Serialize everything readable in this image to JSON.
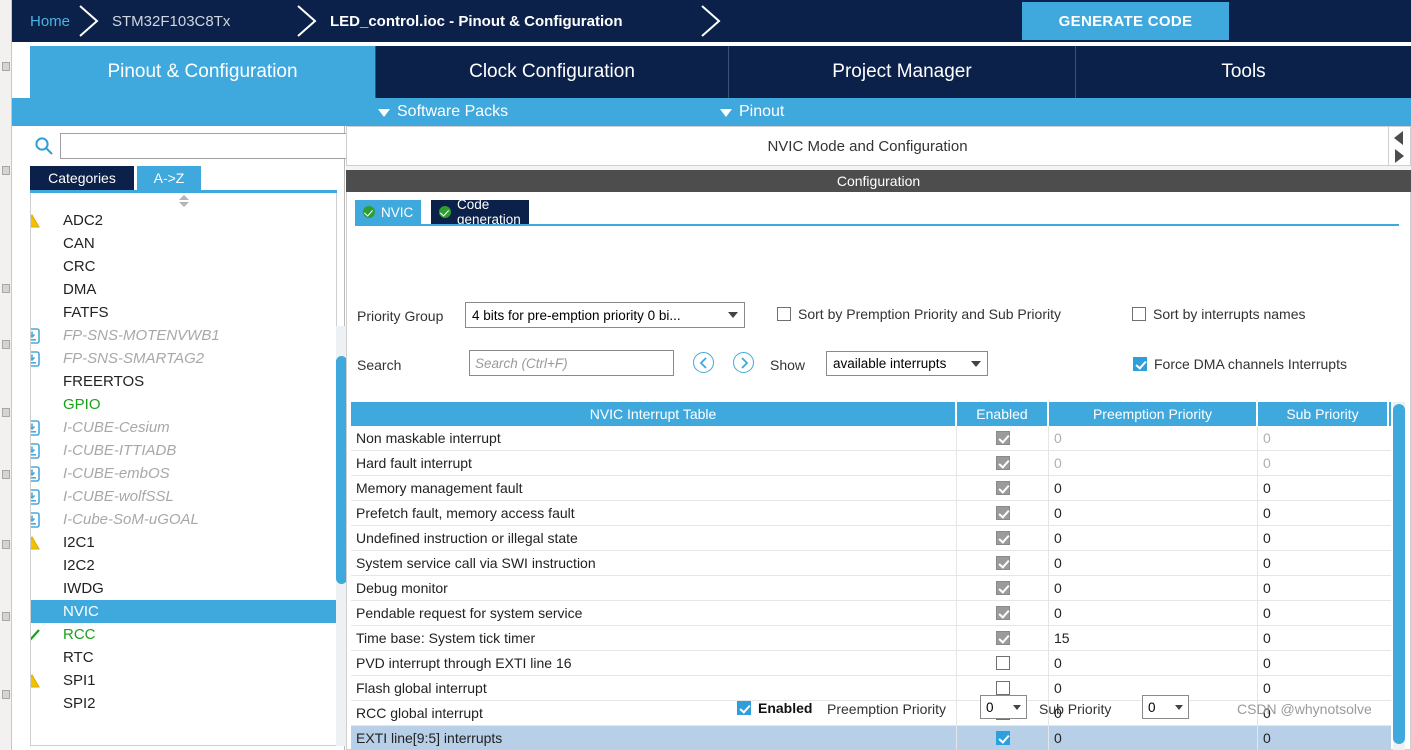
{
  "breadcrumb": {
    "home": "Home",
    "chip": "STM32F103C8Tx",
    "file": "LED_control.ioc - Pinout & Configuration",
    "generate_code": "GENERATE CODE"
  },
  "main_tabs": [
    {
      "label": "Pinout & Configuration",
      "active": true
    },
    {
      "label": "Clock Configuration",
      "active": false
    },
    {
      "label": "Project Manager",
      "active": false
    },
    {
      "label": "Tools",
      "active": false
    }
  ],
  "sub_bar": [
    {
      "label": "Software Packs"
    },
    {
      "label": "Pinout"
    }
  ],
  "sidebar": {
    "search_placeholder": "",
    "search_value": "",
    "search_icon": "search-icon",
    "tabs": [
      {
        "label": "Categories",
        "active": true
      },
      {
        "label": "A->Z",
        "active": false
      }
    ],
    "items": [
      {
        "label": "ADC2",
        "icon": "warning-icon",
        "state": "normal"
      },
      {
        "label": "CAN",
        "icon": "",
        "state": "normal"
      },
      {
        "label": "CRC",
        "icon": "",
        "state": "normal"
      },
      {
        "label": "DMA",
        "icon": "",
        "state": "normal"
      },
      {
        "label": "FATFS",
        "icon": "",
        "state": "normal"
      },
      {
        "label": "FP-SNS-MOTENVWB1",
        "icon": "download-icon",
        "state": "pack"
      },
      {
        "label": "FP-SNS-SMARTAG2",
        "icon": "download-icon",
        "state": "pack"
      },
      {
        "label": "FREERTOS",
        "icon": "",
        "state": "normal"
      },
      {
        "label": "GPIO",
        "icon": "",
        "state": "green"
      },
      {
        "label": "I-CUBE-Cesium",
        "icon": "download-icon",
        "state": "pack"
      },
      {
        "label": "I-CUBE-ITTIADB",
        "icon": "download-icon",
        "state": "pack"
      },
      {
        "label": "I-CUBE-embOS",
        "icon": "download-icon",
        "state": "pack"
      },
      {
        "label": "I-CUBE-wolfSSL",
        "icon": "download-icon",
        "state": "pack"
      },
      {
        "label": "I-Cube-SoM-uGOAL",
        "icon": "download-icon",
        "state": "pack"
      },
      {
        "label": "I2C1",
        "icon": "warning-icon",
        "state": "normal"
      },
      {
        "label": "I2C2",
        "icon": "",
        "state": "normal"
      },
      {
        "label": "IWDG",
        "icon": "",
        "state": "normal"
      },
      {
        "label": "NVIC",
        "icon": "",
        "state": "selected"
      },
      {
        "label": "RCC",
        "icon": "check-icon",
        "state": "green"
      },
      {
        "label": "RTC",
        "icon": "",
        "state": "normal"
      },
      {
        "label": "SPI1",
        "icon": "warning-icon",
        "state": "normal"
      },
      {
        "label": "SPI2",
        "icon": "",
        "state": "normal"
      }
    ]
  },
  "right_panel": {
    "mode_header": "NVIC Mode and Configuration",
    "config_header": "Configuration",
    "config_tabs": [
      {
        "label": "NVIC",
        "active": true
      },
      {
        "label": "Code generation",
        "active": false
      }
    ],
    "priority_group": {
      "label": "Priority Group",
      "value": "4 bits for pre-emption priority 0 bi..."
    },
    "sort_premption": {
      "label": "Sort by Premption Priority and Sub Priority",
      "checked": false
    },
    "sort_names": {
      "label": "Sort by interrupts names",
      "checked": false
    },
    "search": {
      "label": "Search",
      "placeholder": "Search (Ctrl+F)",
      "value": ""
    },
    "nav_prev_icon": "chevron-left-circle-icon",
    "nav_next_icon": "chevron-right-circle-icon",
    "show": {
      "label": "Show",
      "value": "available interrupts"
    },
    "force_dma": {
      "label": "Force DMA channels Interrupts",
      "checked": true
    },
    "table": {
      "columns": [
        "NVIC Interrupt Table",
        "Enabled",
        "Preemption Priority",
        "Sub Priority"
      ],
      "rows": [
        {
          "name": "Non maskable interrupt",
          "enabled": "locked",
          "preemption": "0",
          "sub": "0",
          "dim": true,
          "selected": false
        },
        {
          "name": "Hard fault interrupt",
          "enabled": "locked",
          "preemption": "0",
          "sub": "0",
          "dim": true,
          "selected": false
        },
        {
          "name": "Memory management fault",
          "enabled": "locked",
          "preemption": "0",
          "sub": "0",
          "dim": false,
          "selected": false
        },
        {
          "name": "Prefetch fault, memory access fault",
          "enabled": "locked",
          "preemption": "0",
          "sub": "0",
          "dim": false,
          "selected": false
        },
        {
          "name": "Undefined instruction or illegal state",
          "enabled": "locked",
          "preemption": "0",
          "sub": "0",
          "dim": false,
          "selected": false
        },
        {
          "name": "System service call via SWI instruction",
          "enabled": "locked",
          "preemption": "0",
          "sub": "0",
          "dim": false,
          "selected": false
        },
        {
          "name": "Debug monitor",
          "enabled": "locked",
          "preemption": "0",
          "sub": "0",
          "dim": false,
          "selected": false
        },
        {
          "name": "Pendable request for system service",
          "enabled": "locked",
          "preemption": "0",
          "sub": "0",
          "dim": false,
          "selected": false
        },
        {
          "name": "Time base: System tick timer",
          "enabled": "locked",
          "preemption": "15",
          "sub": "0",
          "dim": false,
          "selected": false
        },
        {
          "name": "PVD interrupt through EXTI line 16",
          "enabled": "off",
          "preemption": "0",
          "sub": "0",
          "dim": false,
          "selected": false
        },
        {
          "name": "Flash global interrupt",
          "enabled": "off",
          "preemption": "0",
          "sub": "0",
          "dim": false,
          "selected": false
        },
        {
          "name": "RCC global interrupt",
          "enabled": "off",
          "preemption": "0",
          "sub": "0",
          "dim": false,
          "selected": false
        },
        {
          "name": "EXTI line[9:5] interrupts",
          "enabled": "on",
          "preemption": "0",
          "sub": "0",
          "dim": false,
          "selected": true
        }
      ]
    },
    "bottom": {
      "enabled_label": "Enabled",
      "enabled_checked": true,
      "preemption_label": "Preemption Priority",
      "preemption_value": "0",
      "sub_label": "Sub Priority",
      "sub_value": "0"
    },
    "watermark": "CSDN @whynotsolve"
  },
  "colors": {
    "brand_blue": "#3fa9dd",
    "navy": "#0b2149",
    "selected_row": "#b8cfe8",
    "warning_yellow": "#f2c200",
    "ok_green": "#1aa11a",
    "header_grey": "#4d4d4d"
  }
}
